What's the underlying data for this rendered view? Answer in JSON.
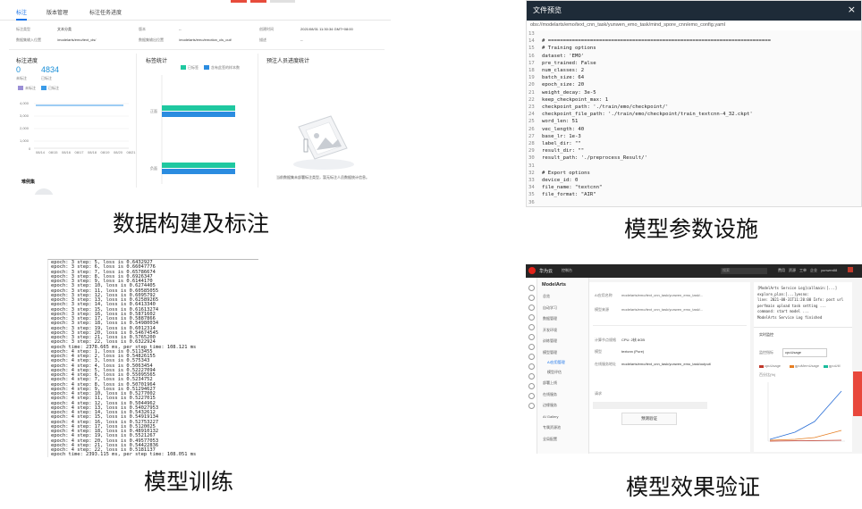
{
  "captions": {
    "p1": "数据构建及标注",
    "p2": "模型参数设施",
    "p3": "模型训练",
    "p4": "模型效果验证"
  },
  "panel1": {
    "tabs": [
      "标注",
      "版本管理",
      "标注任务进度"
    ],
    "info": [
      {
        "k": "标注类型",
        "v": "文本分类"
      },
      {
        "k": "数据集输入位置",
        "v": "/modelarts/emo/text_cls/"
      },
      {
        "k": "版本",
        "v": "--"
      },
      {
        "k": "数据集输出位置",
        "v": "/modelarts/emo/emotion_cls_out/"
      },
      {
        "k": "创建时间",
        "v": "2021/08/31 11:30:34 GMT+08:00"
      },
      {
        "k": "描述",
        "v": "--"
      }
    ],
    "progress": {
      "title": "标注进度",
      "labeled_count": "0",
      "labeled_label": "未标注",
      "unlabeled_count": "4834",
      "unlabeled_label": "已标注",
      "legend": [
        "未标注",
        "已标注"
      ],
      "y_ticks": [
        "4,000",
        "3,000",
        "2,000",
        "1,000",
        "0"
      ],
      "x_ticks": [
        "08/14",
        "08/15",
        "08/16",
        "08/17",
        "08/18",
        "08/19",
        "08/20",
        "08/21"
      ]
    },
    "label_stats": {
      "title": "标签统计",
      "legend": [
        "已标签",
        "含有此签的样本数"
      ],
      "y_labels": [
        "正面",
        "负面"
      ]
    },
    "workforce": {
      "title": "预注人员进度统计",
      "empty_text": "当前数据集未部署标注类型，暂无标注人员数据统计信息。"
    },
    "footer_label": "难例集"
  },
  "panel2": {
    "title": "文件预览",
    "close": "×",
    "path": "obs://modelarts/emo/text_cnn_task/yunwen_emo_task/mind_spore_cnn/emo_config.yaml",
    "lines": [
      {
        "n": "13",
        "t": ""
      },
      {
        "n": "14",
        "t": "# =========================================================================="
      },
      {
        "n": "15",
        "t": "# Training options"
      },
      {
        "n": "16",
        "t": "dataset: 'EMO'"
      },
      {
        "n": "17",
        "t": "pre_trained: False"
      },
      {
        "n": "18",
        "t": "num_classes: 2"
      },
      {
        "n": "19",
        "t": "batch_size: 64"
      },
      {
        "n": "20",
        "t": "epoch_size: 20"
      },
      {
        "n": "21",
        "t": "weight_decay: 3e-5"
      },
      {
        "n": "22",
        "t": "keep_checkpoint_max: 1"
      },
      {
        "n": "23",
        "t": "checkpoint_path: './train/emo/checkpoint/'"
      },
      {
        "n": "24",
        "t": "checkpoint_file_path: './train/emo/checkpoint/train_textcnn-4_32.ckpt'"
      },
      {
        "n": "25",
        "t": "word_len: 51"
      },
      {
        "n": "26",
        "t": "vec_length: 40"
      },
      {
        "n": "27",
        "t": "base_lr: 1e-3"
      },
      {
        "n": "28",
        "t": "label_dir: \"\""
      },
      {
        "n": "29",
        "t": "result_dir: \"\""
      },
      {
        "n": "30",
        "t": "result_path: './preprocess_Result/'"
      },
      {
        "n": "31",
        "t": ""
      },
      {
        "n": "32",
        "t": "# Export options"
      },
      {
        "n": "33",
        "t": "device_id: 0"
      },
      {
        "n": "34",
        "t": "file_name: \"textcnn\""
      },
      {
        "n": "35",
        "t": "file_format: \"AIR\""
      },
      {
        "n": "36",
        "t": ""
      }
    ]
  },
  "panel3": {
    "log": [
      "epoch: 3 step: 5, loss is 0.6432927",
      "epoch: 3 step: 6, loss is 0.66047776",
      "epoch: 3 step: 7, loss is 0.65786674",
      "epoch: 3 step: 8, loss is 0.6926347",
      "epoch: 3 step: 9, loss is 0.6144170",
      "epoch: 3 step: 10, loss is 0.6274405",
      "epoch: 3 step: 11, loss is 0.60585055",
      "epoch: 3 step: 12, loss is 0.6095792",
      "epoch: 3 step: 13, loss is 0.62589265",
      "epoch: 3 step: 14, loss is 0.6413340",
      "epoch: 3 step: 15, loss is 0.61613274",
      "epoch: 3 step: 16, loss is 0.5871602",
      "epoch: 3 step: 17, loss is 0.5887866",
      "epoch: 3 step: 18, loss is 0.54980034",
      "epoch: 3 step: 19, loss is 0.6012314",
      "epoch: 3 step: 20, loss is 0.54674545",
      "epoch: 3 step: 21, loss is 0.5765200",
      "epoch: 3 step: 22, loss is 0.6322924",
      "epoch time: 2378.665 ms, per step time: 108.121 ms",
      "epoch: 4 step: 1, loss is 0.5113455",
      "epoch: 4 step: 2, loss is 0.54826155",
      "epoch: 4 step: 3, loss is 0.575343",
      "epoch: 4 step: 4, loss is 0.5063454",
      "epoch: 4 step: 5, loss is 0.52227094",
      "epoch: 4 step: 6, loss is 0.55095565",
      "epoch: 4 step: 7, loss is 0.5234752",
      "epoch: 4 step: 8, loss is 0.50701964",
      "epoch: 4 step: 9, loss is 0.51294627",
      "epoch: 4 step: 10, loss is 0.5277002",
      "epoch: 4 step: 11, loss is 0.5227015",
      "epoch: 4 step: 12, loss is 0.5044962",
      "epoch: 4 step: 13, loss is 0.54027953",
      "epoch: 4 step: 14, loss is 0.5432612",
      "epoch: 4 step: 15, loss is 0.54919134",
      "epoch: 4 step: 16, loss is 0.52753227",
      "epoch: 4 step: 17, loss is 0.5120025",
      "epoch: 4 step: 18, loss is 0.48910132",
      "epoch: 4 step: 19, loss is 0.5521267",
      "epoch: 4 step: 20, loss is 0.49577053",
      "epoch: 4 step: 21, loss is 0.54422836",
      "epoch: 4 step: 22, loss is 0.5181137",
      "epoch time: 2393.115 ms, per step time: 108.051 ms"
    ]
  },
  "panel4": {
    "brand": "华为云",
    "console": "控制台",
    "search_placeholder": "搜索",
    "top_links": [
      "费用",
      "资源",
      "工单",
      "企业",
      "yunwen88"
    ],
    "product": "ModelArts",
    "nav": [
      "总览",
      "自动学习",
      "数据管理",
      "开发环境",
      "训练管理",
      "模型管理",
      "部署上线",
      "在线服务",
      "边缘服务",
      "AI Gallery",
      "专属资源池",
      "全局配置"
    ],
    "nav_sub": [
      "AI应用管理",
      "模型评估"
    ],
    "form": [
      {
        "k": "AI应用名称",
        "v": "modelarts/emo/text_cnn_task/yunwen_emo_task/..."
      },
      {
        "k": "模型来源",
        "v": "modelarts/emo/text_cnn_task/yunwen_emo_task/..."
      },
      {
        "k": "计算节点规格",
        "v": "CPU: 2核 8GB"
      },
      {
        "k": "模型",
        "v": "textcnn (Pure)"
      },
      {
        "k": "在线服务地址",
        "v": "modelarts/emo/text_cnn_task/yunwen_emo_task/output/"
      }
    ],
    "predict_label": "请求",
    "predict_button": "预测验证",
    "log_lines": [
      "[ModelArts Service Log]callmain:[...]",
      "explore_plan:[...]yesno:",
      "line: 2021-08-31T11:20:00 Info: post url",
      "perfmain upload task setting ...",
      "command: start model ...",
      "ModelArts Service Log finished"
    ],
    "monitor_title": "实时监控",
    "monitor_select_label": "监控指标",
    "monitor_select_value": "cpuUsage",
    "monitor_legend": [
      "cpuUsage",
      "gpuMemUsage",
      "gpuUtil"
    ],
    "monitor_y_label": "百分比(%)",
    "colors": {
      "accent": "#1a73e8",
      "topbar": "#252525",
      "header2": "#1e2b38",
      "red": "#c0392b",
      "orange": "#e67e22",
      "green": "#1abc9c"
    }
  }
}
